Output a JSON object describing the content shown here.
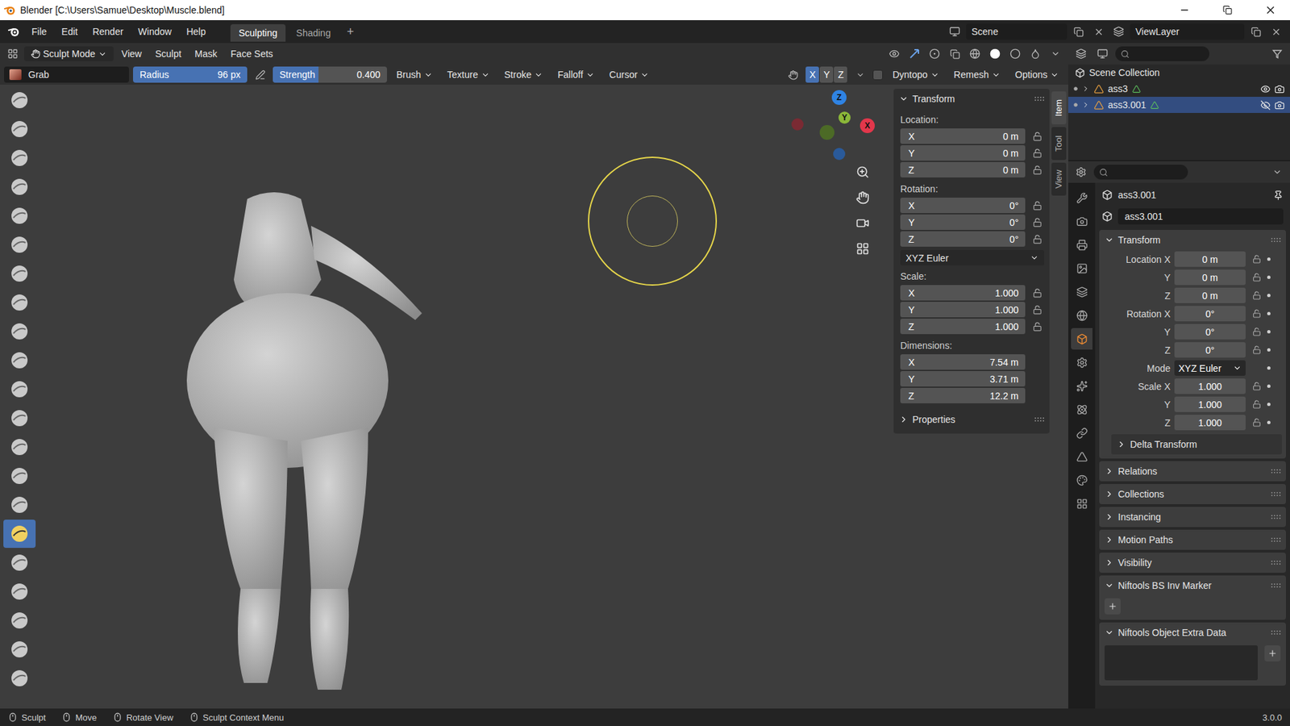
{
  "window": {
    "title": "Blender [C:\\Users\\Samue\\Desktop\\Muscle.blend]"
  },
  "menubar": [
    "File",
    "Edit",
    "Render",
    "Window",
    "Help"
  ],
  "workspaces": [
    {
      "label": "Sculpting",
      "selected": true
    },
    {
      "label": "Shading",
      "selected": false
    }
  ],
  "add_workspace": "+",
  "scene": "Scene",
  "view_layer": "ViewLayer",
  "viewport_header": {
    "mode": "Sculpt Mode",
    "menus": [
      "View",
      "Sculpt",
      "Mask",
      "Face Sets"
    ]
  },
  "tool_settings": {
    "brush": "Grab",
    "radius": {
      "label": "Radius",
      "value": "96 px"
    },
    "strength": {
      "label": "Strength",
      "value": "0.400",
      "level": 0.4
    },
    "menus": [
      "Brush",
      "Texture",
      "Stroke",
      "Falloff",
      "Cursor"
    ],
    "symmetry": [
      {
        "label": "X",
        "selected": true
      },
      {
        "label": "Y",
        "selected": false
      },
      {
        "label": "Z",
        "selected": false
      }
    ],
    "dyntopo": {
      "label": "Dyntopo",
      "checked": false
    },
    "menus_right": [
      "Remesh",
      "Options"
    ]
  },
  "toolbar": [
    {
      "selected": false
    },
    {
      "selected": false
    },
    {
      "selected": false
    },
    {
      "selected": false
    },
    {
      "selected": false
    },
    {
      "selected": false
    },
    {
      "selected": false
    },
    {
      "selected": false
    },
    {
      "selected": false
    },
    {
      "selected": false
    },
    {
      "selected": false
    },
    {
      "selected": false
    },
    {
      "selected": false
    },
    {
      "selected": false
    },
    {
      "selected": false
    },
    {
      "selected": true
    },
    {
      "selected": false
    },
    {
      "selected": false
    },
    {
      "selected": false
    },
    {
      "selected": false
    },
    {
      "selected": false
    }
  ],
  "gizmo": [
    {
      "label": "Z",
      "color": "#2f83e3"
    },
    {
      "label": "Y",
      "color": "#8bb739"
    },
    {
      "label": "X",
      "color": "#e2374b"
    }
  ],
  "n_panel": {
    "tabs": [
      {
        "label": "Item",
        "selected": true
      },
      {
        "label": "Tool",
        "selected": false
      },
      {
        "label": "View",
        "selected": false
      }
    ],
    "title": "Transform",
    "groups": [
      {
        "label": "Location:",
        "locked": true,
        "fields": [
          {
            "axis": "X",
            "value": "0 m"
          },
          {
            "axis": "Y",
            "value": "0 m"
          },
          {
            "axis": "Z",
            "value": "0 m"
          }
        ]
      },
      {
        "label": "Rotation:",
        "locked": true,
        "mode": "XYZ Euler",
        "fields": [
          {
            "axis": "X",
            "value": "0°"
          },
          {
            "axis": "Y",
            "value": "0°"
          },
          {
            "axis": "Z",
            "value": "0°"
          }
        ]
      },
      {
        "label": "Scale:",
        "locked": true,
        "fields": [
          {
            "axis": "X",
            "value": "1.000"
          },
          {
            "axis": "Y",
            "value": "1.000"
          },
          {
            "axis": "Z",
            "value": "1.000"
          }
        ]
      },
      {
        "label": "Dimensions:",
        "locked": false,
        "fields": [
          {
            "axis": "X",
            "value": "7.54 m"
          },
          {
            "axis": "Y",
            "value": "3.71 m"
          },
          {
            "axis": "Z",
            "value": "12.2 m"
          }
        ]
      }
    ],
    "properties_panel": {
      "label": "Properties",
      "expanded": false
    }
  },
  "outliner": {
    "root": "Scene Collection",
    "items": [
      {
        "name": "ass3",
        "selected": false,
        "visible": true
      },
      {
        "name": "ass3.001",
        "selected": true,
        "visible": false
      }
    ]
  },
  "properties": {
    "tabs": [
      {
        "selected": false
      },
      {
        "selected": false
      },
      {
        "selected": false
      },
      {
        "selected": false
      },
      {
        "selected": false
      },
      {
        "selected": false
      },
      {
        "selected": true
      },
      {
        "selected": false
      },
      {
        "selected": false
      },
      {
        "selected": false
      },
      {
        "selected": false
      },
      {
        "selected": false
      },
      {
        "selected": false
      },
      {
        "selected": false
      }
    ],
    "object_name": "ass3.001",
    "datablock": "ass3.001",
    "transform": {
      "title": "Transform",
      "expanded": true,
      "rows": [
        {
          "label": "Location X",
          "value": "0 m",
          "kind": "number"
        },
        {
          "label": "Y",
          "value": "0 m",
          "kind": "number"
        },
        {
          "label": "Z",
          "value": "0 m",
          "kind": "number"
        },
        {
          "label": "Rotation X",
          "value": "0°",
          "kind": "number"
        },
        {
          "label": "Y",
          "value": "0°",
          "kind": "number"
        },
        {
          "label": "Z",
          "value": "0°",
          "kind": "number"
        },
        {
          "label": "Mode",
          "value": "XYZ Euler",
          "kind": "dropdown"
        },
        {
          "label": "Scale X",
          "value": "1.000",
          "kind": "number"
        },
        {
          "label": "Y",
          "value": "1.000",
          "kind": "number"
        },
        {
          "label": "Z",
          "value": "1.000",
          "kind": "number"
        }
      ]
    },
    "panels": [
      {
        "label": "Delta Transform",
        "expanded": false,
        "kind": "subpanel"
      },
      {
        "label": "Relations",
        "expanded": false,
        "kind": "panel"
      },
      {
        "label": "Collections",
        "expanded": false,
        "kind": "panel"
      },
      {
        "label": "Instancing",
        "expanded": false,
        "kind": "panel"
      },
      {
        "label": "Motion Paths",
        "expanded": false,
        "kind": "panel"
      },
      {
        "label": "Visibility",
        "expanded": false,
        "kind": "panel"
      },
      {
        "label": "Niftools BS Inv Marker",
        "expanded": true,
        "kind": "panel"
      },
      {
        "label": "Niftools Object Extra Data",
        "expanded": true,
        "kind": "panel"
      }
    ]
  },
  "status_bar": {
    "items": [
      {
        "label": "Sculpt"
      },
      {
        "label": "Move"
      },
      {
        "label": "Rotate View"
      },
      {
        "label": "Sculpt Context Menu"
      }
    ],
    "version": "3.0.0"
  }
}
